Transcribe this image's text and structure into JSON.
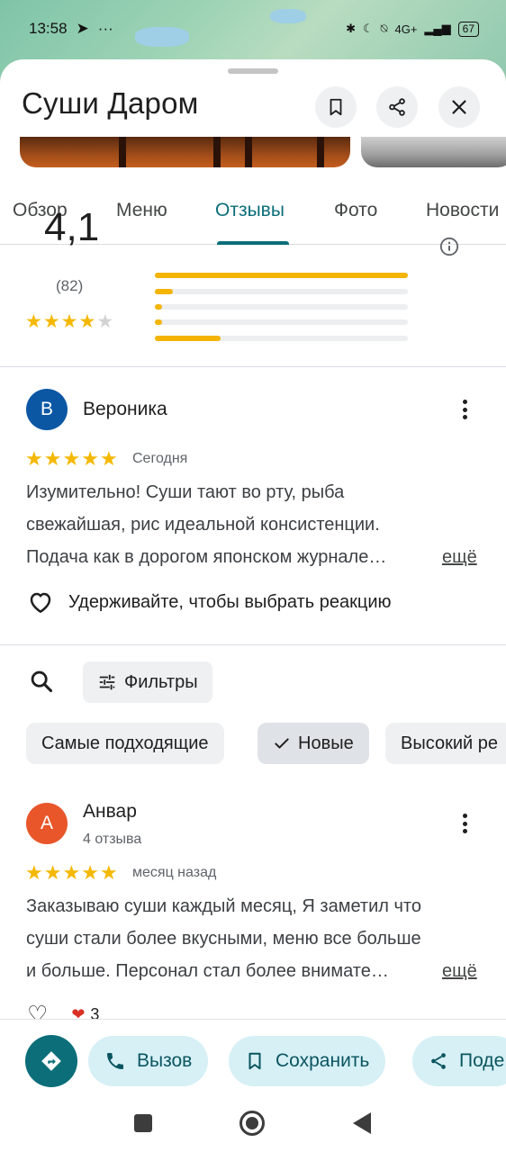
{
  "status_bar": {
    "time": "13:58",
    "network": "4G+",
    "battery": "67"
  },
  "place": {
    "title": "Суши Даром",
    "icons": [
      "bookmark-icon",
      "share-icon",
      "close-icon"
    ]
  },
  "tabs": [
    {
      "label": "Обзор",
      "active": false
    },
    {
      "label": "Меню",
      "active": false
    },
    {
      "label": "Отзывы",
      "active": true
    },
    {
      "label": "Фото",
      "active": false
    },
    {
      "label": "Новости",
      "active": false
    }
  ],
  "summary": {
    "rating": "4,1",
    "stars": 4,
    "count": "(82)",
    "distribution": [
      {
        "stars": 5,
        "fraction": 1.0
      },
      {
        "stars": 4,
        "fraction": 0.07
      },
      {
        "stars": 3,
        "fraction": 0.03
      },
      {
        "stars": 2,
        "fraction": 0.03
      },
      {
        "stars": 1,
        "fraction": 0.26
      }
    ]
  },
  "featured_review": {
    "initial": "В",
    "avatar_color": "#0b57a4",
    "author": "Вероника",
    "stars": 5,
    "date": "Сегодня",
    "lines": [
      "Изумительно! Суши тают во рту, рыба",
      "свежайшая, рис идеальной консистенции.",
      "Подача как в дорогом японском журнале…"
    ],
    "more": "ещё",
    "reaction_hint": "Удерживайте, чтобы выбрать реакцию"
  },
  "filters": {
    "filter_label": "Фильтры",
    "chips": [
      {
        "label": "Самые подходящие",
        "selected": false
      },
      {
        "label": "Новые",
        "selected": true
      },
      {
        "label": "Высокий ре",
        "selected": false
      }
    ]
  },
  "review_2": {
    "initial": "А",
    "avatar_color": "#e8562a",
    "author": "Анвар",
    "sub": "4 отзыва",
    "stars": 5,
    "date": "месяц назад",
    "lines": [
      "Заказываю суши каждый месяц, Я заметил что",
      "суши стали более вкусными, меню все больше",
      "и больше. Персонал стал более внимате…"
    ],
    "more": "ещё",
    "likes": "3"
  },
  "actions": {
    "call": "Вызов",
    "save": "Сохранить",
    "share": "Поде"
  },
  "colors": {
    "accent": "#0b6e79",
    "star": "#f5b800",
    "pill_bg": "#d6f0f6"
  }
}
